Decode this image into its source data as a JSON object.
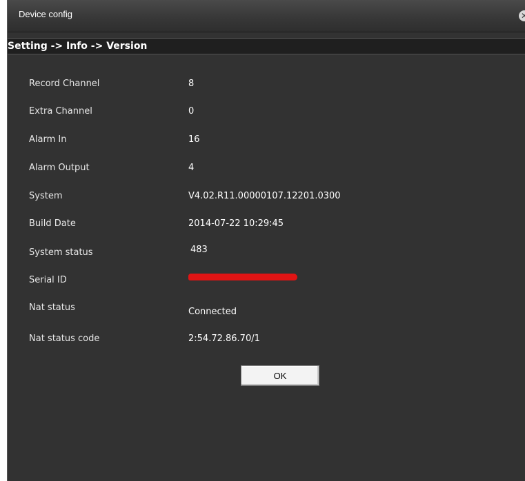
{
  "window": {
    "title": "Device config",
    "close_glyph": "✕"
  },
  "breadcrumb": "Setting -> Info -> Version",
  "info": {
    "rows": [
      {
        "label": "Record Channel",
        "value": "8"
      },
      {
        "label": "Extra Channel",
        "value": "0"
      },
      {
        "label": "Alarm In",
        "value": "16"
      },
      {
        "label": "Alarm Output",
        "value": "4"
      },
      {
        "label": "System",
        "value": "V4.02.R11.00000107.12201.0300"
      },
      {
        "label": "Build Date",
        "value": "2014-07-22 10:29:45"
      },
      {
        "label": "System status",
        "value": "483"
      },
      {
        "label": "Serial ID",
        "value": ""
      },
      {
        "label": "Nat status",
        "value": "Connected"
      },
      {
        "label": "Nat status code",
        "value": "2:54.72.86.70/1"
      }
    ]
  },
  "ok_label": "OK",
  "colors": {
    "background": "#323232",
    "redaction": "#e01414"
  }
}
